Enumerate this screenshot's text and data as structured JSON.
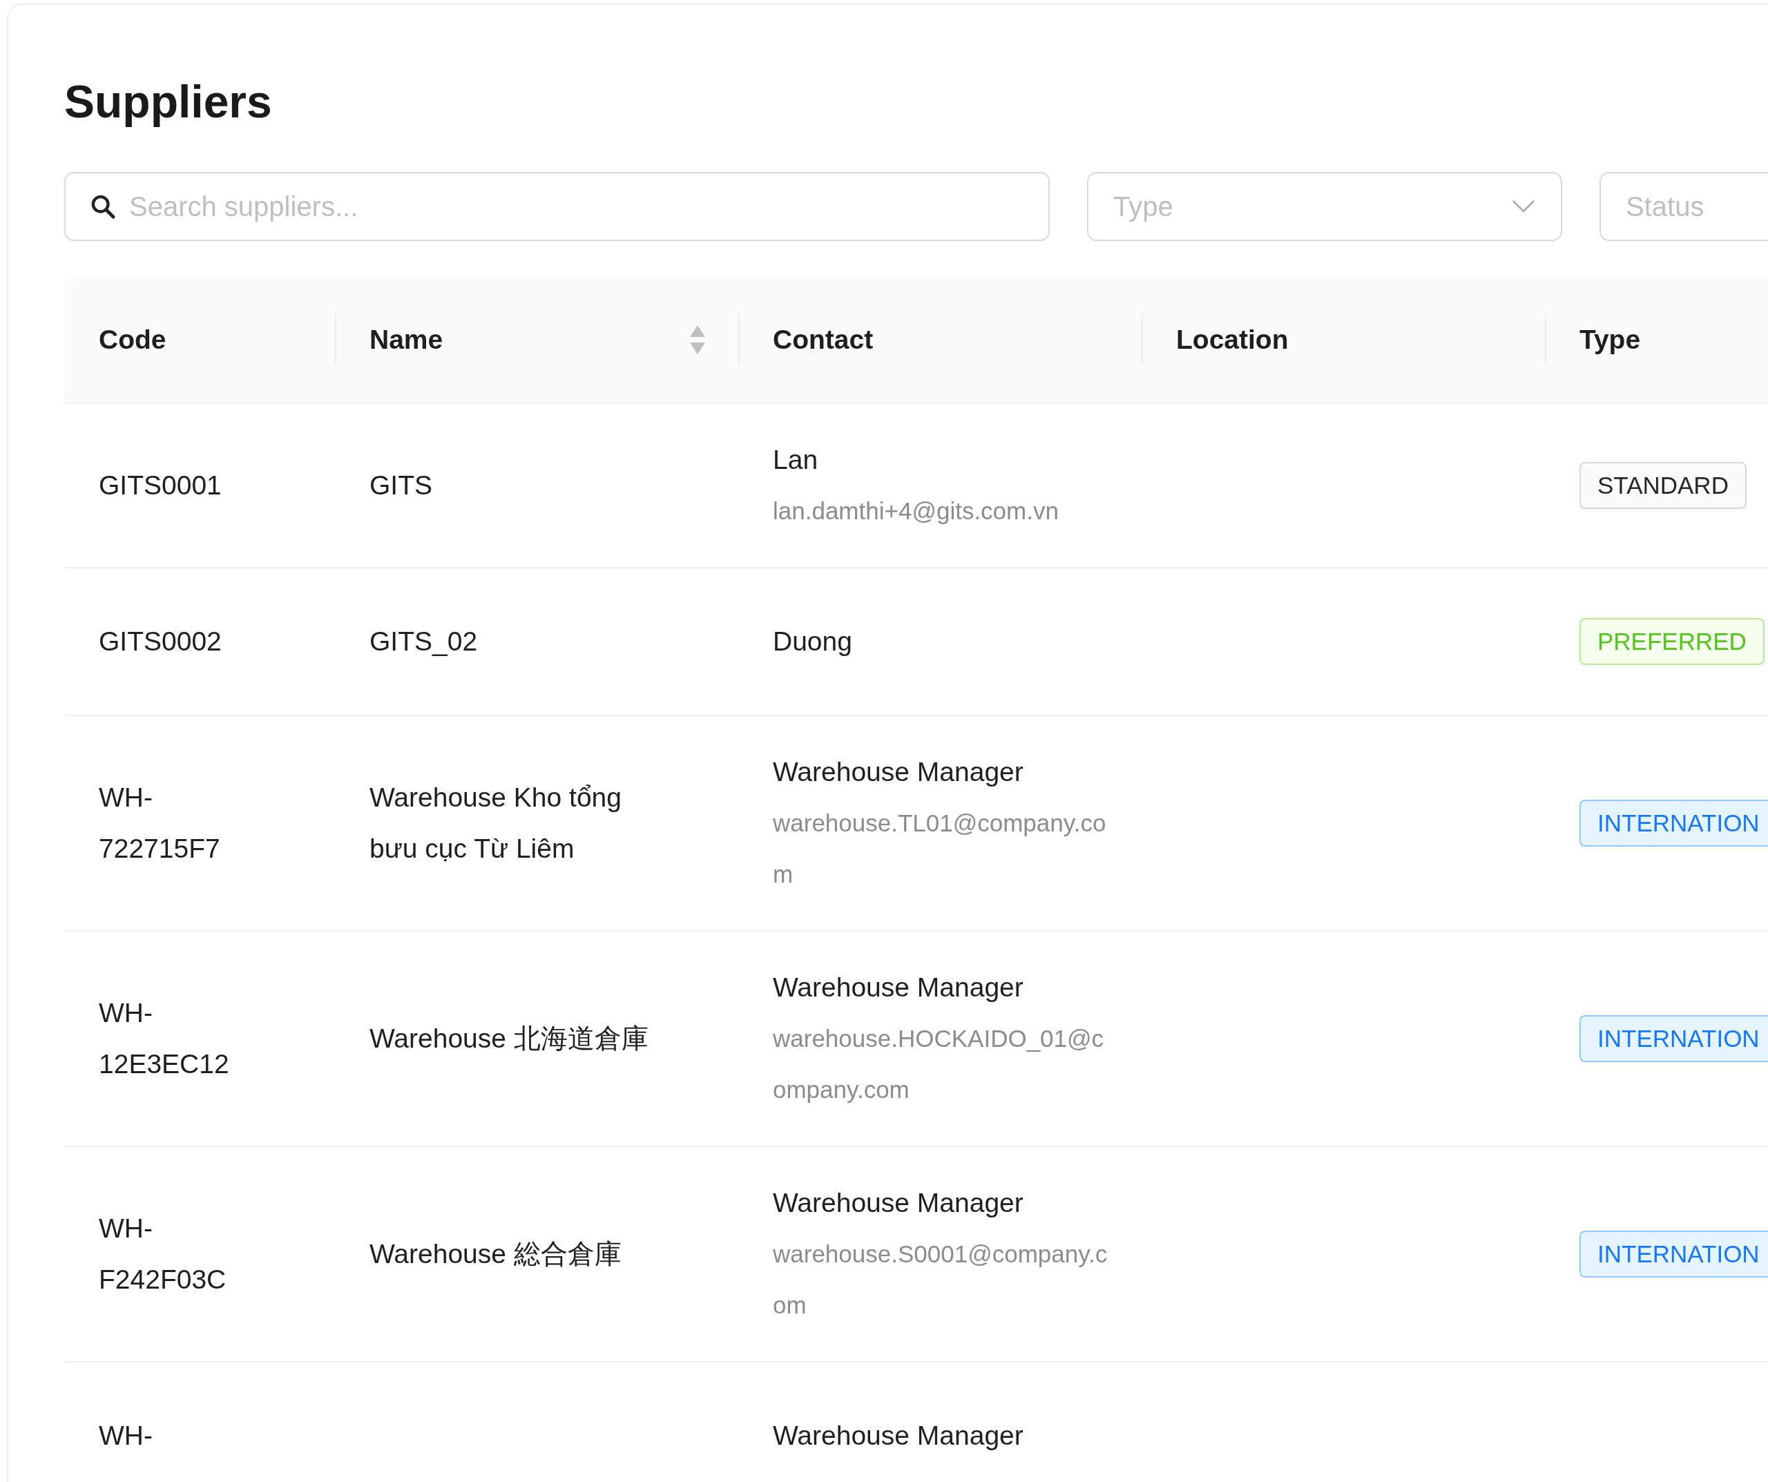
{
  "title": "Suppliers",
  "search": {
    "placeholder": "Search suppliers..."
  },
  "filters": [
    {
      "placeholder": "Type",
      "dropdown": true
    },
    {
      "placeholder": "Status"
    }
  ],
  "table": {
    "columns": [
      {
        "label": "Code",
        "sortable": false
      },
      {
        "label": "Name",
        "sortable": true
      },
      {
        "label": "Contact",
        "sortable": false
      },
      {
        "label": "Location",
        "sortable": false
      },
      {
        "label": "Type"
      }
    ],
    "rows": [
      {
        "code": "GITS0001",
        "name": "GITS",
        "contact_name": "Lan",
        "contact_email": "lan.damthi+4@gits.com.vn",
        "type": {
          "label": "STANDARD",
          "kind": "standard"
        }
      },
      {
        "code": "GITS0002",
        "name": "GITS_02",
        "contact_name": "Duong",
        "type": {
          "label": "PREFERRED",
          "kind": "preferred"
        }
      },
      {
        "code": "WH-722715F7",
        "name": "Warehouse Kho tổng bưu cục Từ Liêm",
        "contact_name": "Warehouse Manager",
        "contact_email": "warehouse.TL01@company.com",
        "type": {
          "label": "INTERNATION",
          "kind": "international"
        }
      },
      {
        "code": "WH-12E3EC12",
        "name": "Warehouse 北海道倉庫",
        "contact_name": "Warehouse Manager",
        "contact_email": "warehouse.HOCKAIDO_01@company.com",
        "type": {
          "label": "INTERNATION",
          "kind": "international"
        }
      },
      {
        "code": "WH-F242F03C",
        "name": "Warehouse 総合倉庫",
        "contact_name": "Warehouse Manager",
        "contact_email": "warehouse.S0001@company.com",
        "type": {
          "label": "INTERNATION",
          "kind": "international"
        }
      },
      {
        "code": "WH-",
        "contact_name": "Warehouse Manager"
      }
    ]
  }
}
